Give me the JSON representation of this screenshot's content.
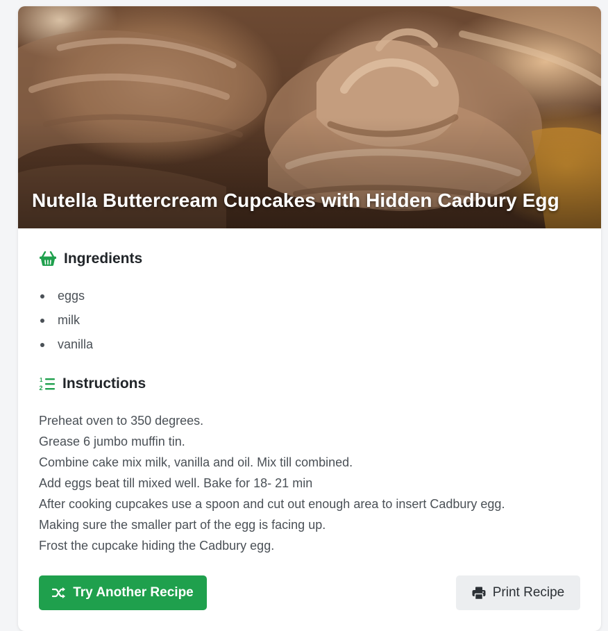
{
  "recipe": {
    "title": "Nutella Buttercream Cupcakes with Hidden Cadbury Egg",
    "hero_image": "nutella-buttercream-cupcakes-photo"
  },
  "ingredients": {
    "heading": "Ingredients",
    "icon": "basket-icon",
    "items": [
      "eggs",
      "milk",
      "vanilla"
    ]
  },
  "instructions": {
    "heading": "Instructions",
    "icon": "ordered-list-icon",
    "steps": [
      "Preheat oven to 350 degrees.",
      "Grease 6 jumbo muffin tin.",
      "Combine cake mix milk, vanilla and oil. Mix till combined.",
      "Add eggs beat till mixed well. Bake for 18- 21 min",
      "After cooking cupcakes use a spoon and cut out enough area to insert Cadbury egg.",
      "Making sure the smaller part of the egg is facing up.",
      "Frost the cupcake hiding the Cadbury egg."
    ]
  },
  "actions": {
    "try_another_label": "Try Another Recipe",
    "try_another_icon": "shuffle-icon",
    "print_label": "Print Recipe",
    "print_icon": "printer-icon"
  },
  "colors": {
    "accent": "#1fa04d",
    "body_text": "#4a5056",
    "heading_text": "#212529",
    "secondary_button": "#eceef0"
  }
}
